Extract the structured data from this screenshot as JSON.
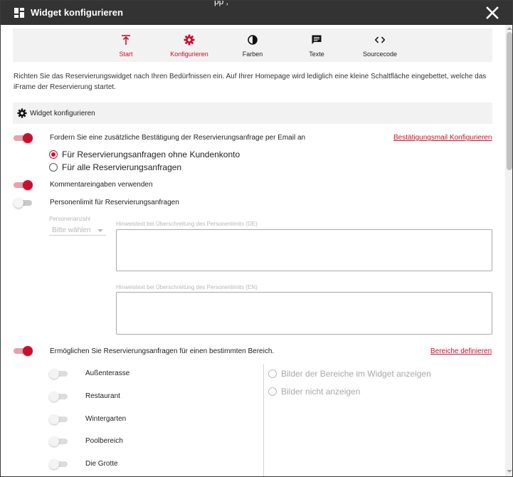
{
  "dialog": {
    "title": "Widget konfigurieren",
    "background_glimpse": "pp      ,   "
  },
  "tabs": [
    {
      "label": "Start",
      "icon": "vertical-align-top-icon",
      "active": true
    },
    {
      "label": "Konfigurieren",
      "icon": "gear-icon",
      "active": true
    },
    {
      "label": "Farben",
      "icon": "contrast-icon",
      "active": false
    },
    {
      "label": "Texte",
      "icon": "message-icon",
      "active": false
    },
    {
      "label": "Sourcecode",
      "icon": "code-icon",
      "active": false
    }
  ],
  "intro_text": "Richten Sie das Reservierungswidget nach Ihren Bedürfnissen ein. Auf Ihrer Homepage wird lediglich eine kleine Schaltfläche eingebettet, welche das iFrame der Reservierung startet.",
  "section": {
    "title": "Widget konfigurieren",
    "icon": "gear-icon"
  },
  "confirmation": {
    "enabled": true,
    "label": "Fordern Sie eine zusätzliche Bestätigung der Reservierungsanfrage per Email an",
    "link_label": "Bestätigungsmail Konfigurieren",
    "options": [
      {
        "label": "Für Reservierungsanfragen ohne Kundenkonto",
        "selected": true
      },
      {
        "label": "Für alle Reservierungsanfragen",
        "selected": false
      }
    ]
  },
  "comments": {
    "enabled": true,
    "label": "Kommentareingaben verwenden"
  },
  "person_limit": {
    "enabled": false,
    "label": "Personenlimit für Reservierungsanfragen",
    "count_label": "Personenanzahl",
    "count_value": "Bitte wählen",
    "hint_de_label": "Hinweistext bei Überschreitung des Personenlimits (DE)",
    "hint_de_value": "",
    "hint_en_label": "Hinweistext bei Überschreitung des Personenlimits (EN)",
    "hint_en_value": ""
  },
  "areas": {
    "enabled": true,
    "label": "Ermöglichen Sie Reservierungsanfragen für einen bestimmten Bereich.",
    "link_label": "Bereiche definieren",
    "items": [
      {
        "label": "Außenterasse",
        "enabled": false
      },
      {
        "label": "Restaurant",
        "enabled": false
      },
      {
        "label": "Wintergarten",
        "enabled": false
      },
      {
        "label": "Poolbereich",
        "enabled": false
      },
      {
        "label": "Die Grotte",
        "enabled": false
      }
    ],
    "image_options": [
      {
        "label": "Bilder der Bereiche im Widget anzeigen",
        "selected": false
      },
      {
        "label": "Bilder nicht anzeigen",
        "selected": false
      }
    ]
  },
  "colors": {
    "accent": "#c8102e",
    "titlebar": "#333333"
  }
}
